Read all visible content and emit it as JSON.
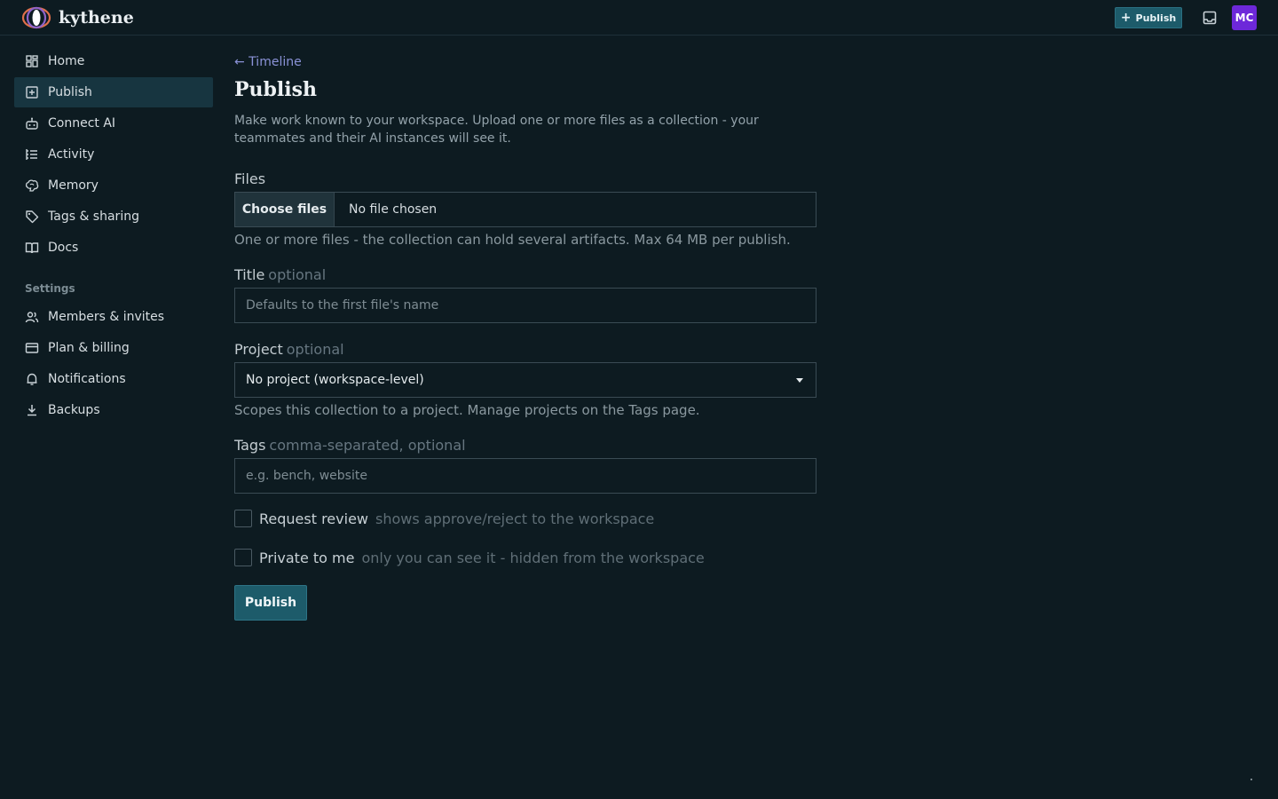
{
  "app": {
    "name": "kythene",
    "publish_button": "Publish",
    "avatar_initials": "MC",
    "accent_color": "#1d5b6a",
    "avatar_color": "#6d28d9"
  },
  "sidebar": {
    "items": [
      {
        "label": "Home",
        "icon": "dashboard-icon"
      },
      {
        "label": "Publish",
        "icon": "plus-square-icon",
        "active": true
      },
      {
        "label": "Connect AI",
        "icon": "robot-icon"
      },
      {
        "label": "Activity",
        "icon": "activity-list-icon"
      },
      {
        "label": "Memory",
        "icon": "brain-icon"
      },
      {
        "label": "Tags & sharing",
        "icon": "tag-icon"
      },
      {
        "label": "Docs",
        "icon": "book-icon"
      }
    ],
    "settings_heading": "Settings",
    "settings_items": [
      {
        "label": "Members & invites",
        "icon": "users-icon"
      },
      {
        "label": "Plan & billing",
        "icon": "credit-card-icon"
      },
      {
        "label": "Notifications",
        "icon": "bell-icon"
      },
      {
        "label": "Backups",
        "icon": "download-icon"
      }
    ]
  },
  "main": {
    "back_link": "← Timeline",
    "title": "Publish",
    "description": "Make work known to your workspace. Upload one or more files as a collection - your teammates and their AI instances will see it.",
    "files": {
      "label": "Files",
      "button": "Choose files",
      "status": "No file chosen",
      "hint": "One or more files - the collection can hold several artifacts. Max 64 MB per publish."
    },
    "title_field": {
      "label": "Title",
      "qualifier": "optional",
      "placeholder": "Defaults to the first file's name"
    },
    "project": {
      "label": "Project",
      "qualifier": "optional",
      "selected": "No project (workspace-level)",
      "hint": "Scopes this collection to a project. Manage projects on the Tags page."
    },
    "tags": {
      "label": "Tags",
      "qualifier": "comma-separated, optional",
      "placeholder": "e.g. bench, website"
    },
    "request_review": {
      "label": "Request review",
      "hint": "shows approve/reject to the workspace",
      "checked": false
    },
    "private": {
      "label": "Private to me",
      "hint": "only you can see it - hidden from the workspace",
      "checked": false
    },
    "submit": "Publish"
  }
}
